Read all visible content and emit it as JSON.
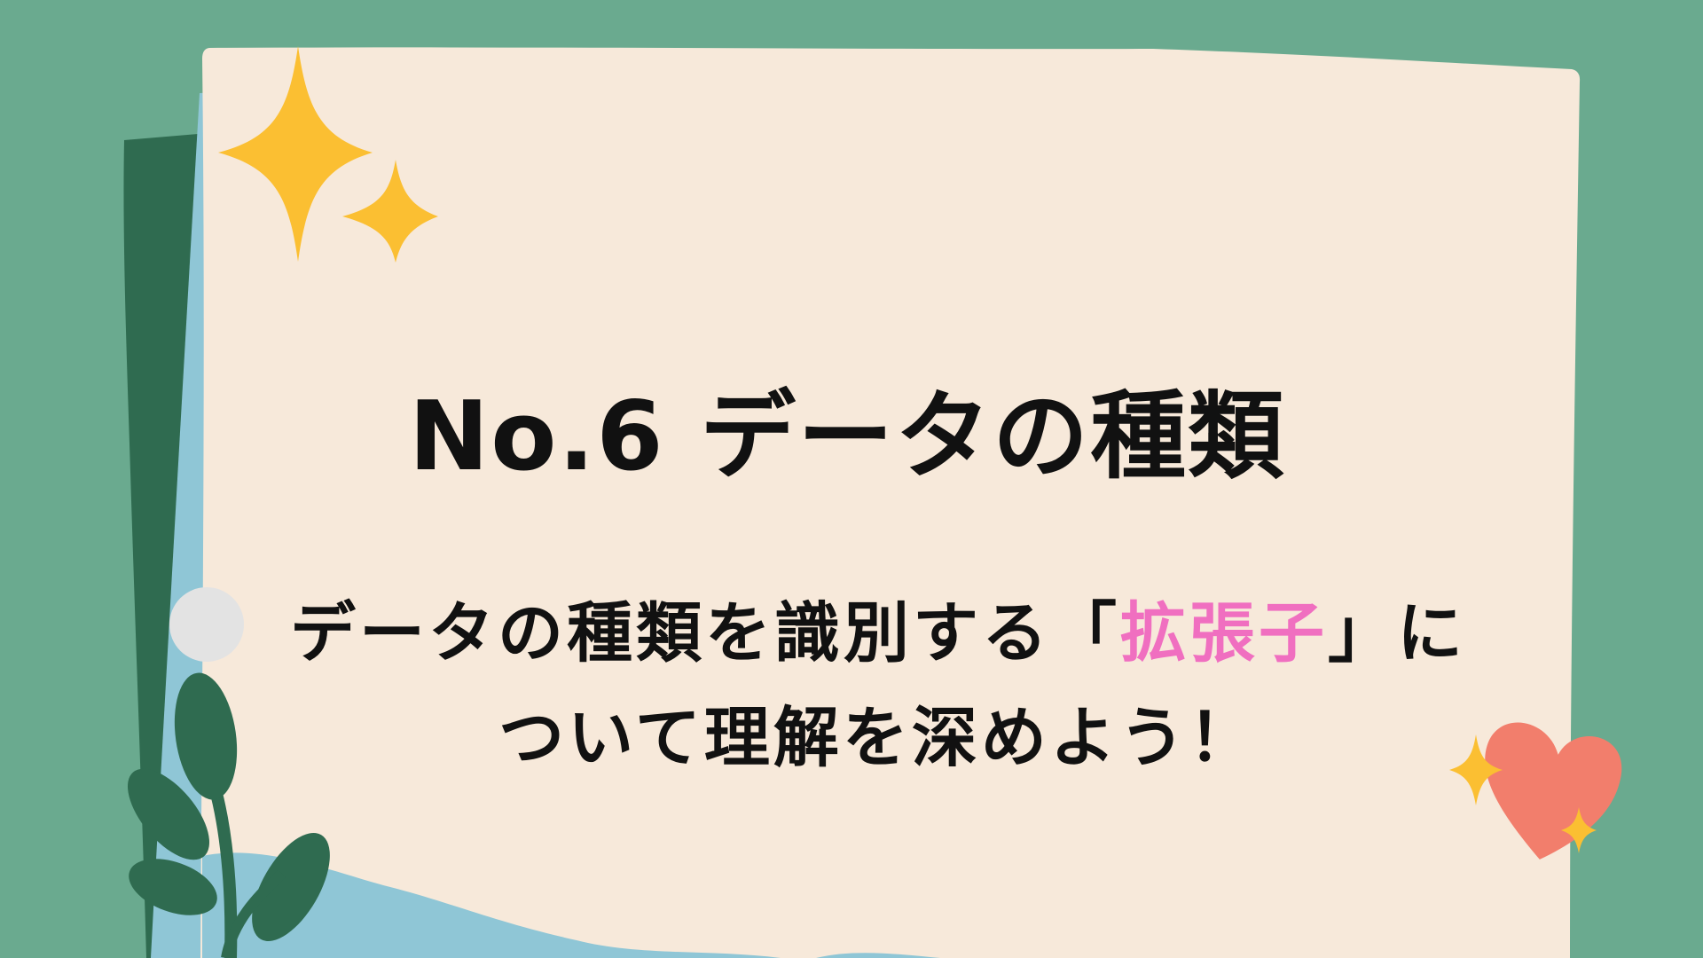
{
  "title": "No.6 データの種類",
  "subtitle": {
    "before": "データの種類を識別する「",
    "highlight": "拡張子",
    "after": "」に",
    "line2": "ついて理解を深めよう！"
  },
  "colors": {
    "background": "#6aaa8f",
    "paper": "#f7e9da",
    "dark_green": "#2f6b50",
    "light_blue": "#8fc6d6",
    "sparkle_yellow": "#fbbf32",
    "heart_coral": "#f27e6c",
    "highlight_pink": "#f06fc0",
    "dot_gray": "#e3e3e3"
  },
  "decorations": [
    "sparkle-icon",
    "heart-icon",
    "leaf-plant-icon",
    "bullet-dot-icon"
  ]
}
